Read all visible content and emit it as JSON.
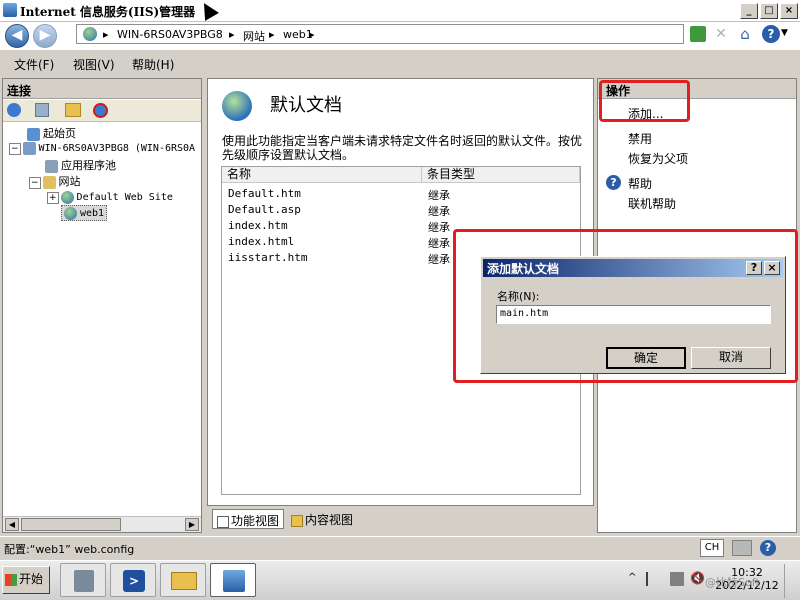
{
  "window": {
    "title": "Internet 信息服务(IIS)管理器",
    "min_label": "_",
    "max_label": "□",
    "close_label": "×"
  },
  "address": {
    "segments": [
      "WIN-6RS0AV3PBG8",
      "网站",
      "web1"
    ],
    "help_label": "?"
  },
  "menu": {
    "items": [
      "文件(F)",
      "视图(V)",
      "帮助(H)"
    ]
  },
  "connections": {
    "header": "连接",
    "tree": [
      {
        "label": "起始页",
        "level": 1
      },
      {
        "label": "WIN-6RS0AV3PBG8 (WIN-6RS0A",
        "level": 1
      },
      {
        "label": "应用程序池",
        "level": 2
      },
      {
        "label": "网站",
        "level": 2
      },
      {
        "label": "Default Web Site",
        "level": 3
      },
      {
        "label": "web1",
        "level": 3,
        "selected": true
      }
    ]
  },
  "feature": {
    "title": "默认文档",
    "description": "使用此功能指定当客户端未请求特定文件名时返回的默认文件。按优先级顺序设置默认文档。",
    "columns": [
      "名称",
      "条目类型"
    ],
    "rows": [
      {
        "name": "Default.htm",
        "type": "继承"
      },
      {
        "name": "Default.asp",
        "type": "继承"
      },
      {
        "name": "index.htm",
        "type": "继承"
      },
      {
        "name": "index.html",
        "type": "继承"
      },
      {
        "name": "iisstart.htm",
        "type": "继承"
      }
    ]
  },
  "view_tabs": {
    "features": "功能视图",
    "content": "内容视图"
  },
  "actions": {
    "header": "操作",
    "add": "添加...",
    "disable": "禁用",
    "revert": "恢复为父项",
    "help": "帮助",
    "online_help": "联机帮助"
  },
  "status": {
    "text": "配置:“web1” web.config",
    "lang": "CH"
  },
  "dialog": {
    "title": "添加默认文档",
    "name_label": "名称(N):",
    "name_value": "main.htm",
    "ok": "确定",
    "cancel": "取消",
    "help_btn": "?",
    "close_btn": "×"
  },
  "taskbar": {
    "start": "开始",
    "time": "10:32",
    "date": "2022/12/12",
    "tray_text": "@比特Soft"
  },
  "colors": {
    "highlight": "#e02020",
    "dialog_title": "#0a246a",
    "selection": "#3169c6"
  }
}
